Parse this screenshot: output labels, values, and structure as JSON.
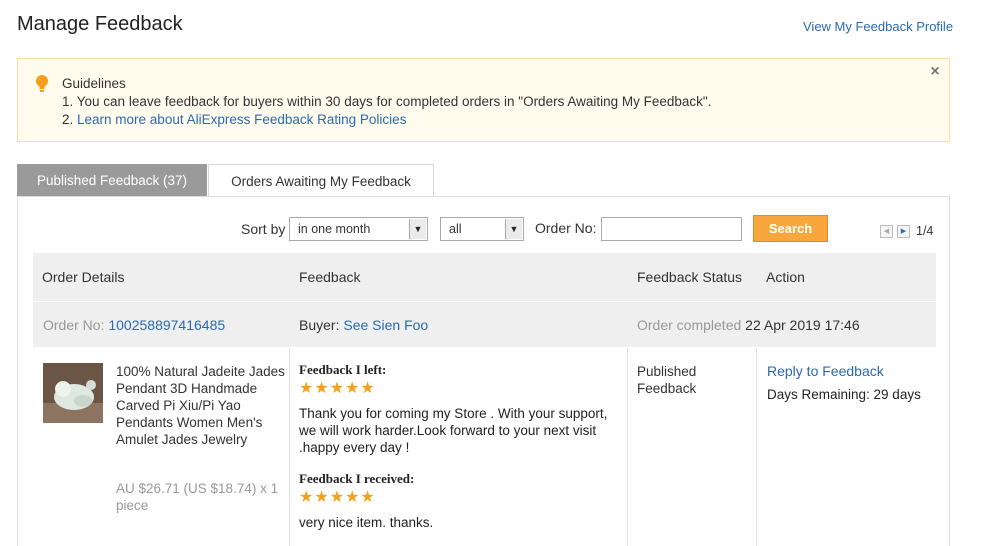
{
  "header": {
    "title": "Manage Feedback",
    "profile_link": "View My Feedback Profile"
  },
  "guidelines": {
    "title": "Guidelines",
    "line1": "1. You can leave feedback for buyers within 30 days for completed orders in \"Orders Awaiting My Feedback\".",
    "line2_prefix": "2. ",
    "line2_link": "Learn more about AliExpress Feedback Rating Policies",
    "close_glyph": "×"
  },
  "tabs": [
    {
      "label": "Published Feedback (37)",
      "active": true
    },
    {
      "label": "Orders Awaiting My Feedback",
      "active": false
    }
  ],
  "filters": {
    "sort_label": "Sort by",
    "period_value": "in one month",
    "type_value": "all",
    "order_label": "Order No:",
    "order_value": "",
    "search_label": "Search"
  },
  "pager": {
    "prev_glyph": "◀",
    "next_glyph": "▶",
    "count": "1/4"
  },
  "table": {
    "headers": [
      "Order Details",
      "Feedback",
      "Feedback Status",
      "Action"
    ]
  },
  "order": {
    "order_no_label": "Order No: ",
    "order_no": "100258897416485",
    "buyer_label": "Buyer: ",
    "buyer_name": "See Sien Foo",
    "status_label": "Order completed ",
    "completed_at": "22 Apr 2019 17:46",
    "product_title": "100% Natural Jadeite Jades Pendant 3D Handmade Carved Pi Xiu/Pi Yao Pendants Women Men's Amulet Jades Jewelry",
    "price": "AU $26.71 (US $18.74) x 1 piece",
    "left_heading": "Feedback I left:",
    "left_stars": "★★★★★",
    "left_rating": 5,
    "left_text": "Thank you for coming my Store . With your support, we will work harder.Look forward to your next visit .happy every day !",
    "received_heading": "Feedback I received:",
    "received_stars": "★★★★★",
    "received_rating": 5,
    "received_text": "very nice item. thanks.",
    "feedback_status": "Published Feedback",
    "action_link": "Reply to Feedback",
    "days_remaining": "Days Remaining: 29 days"
  },
  "colors": {
    "link": "#2a6ab3",
    "accent_button": "#f7a73b",
    "star": "#f5a01a",
    "notice_bg": "#fffbed"
  },
  "icons": [
    "bulb-icon",
    "close-icon",
    "chevron-down-icon",
    "pager-prev-icon",
    "pager-next-icon",
    "star-icon"
  ]
}
